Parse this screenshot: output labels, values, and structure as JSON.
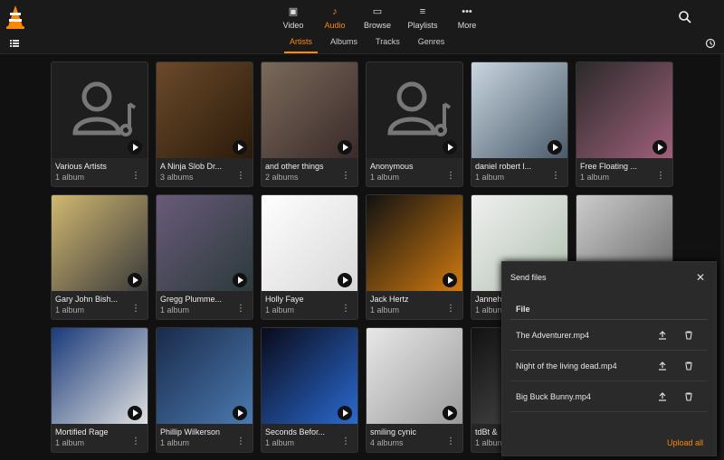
{
  "nav": [
    {
      "label": "Video",
      "icon": "film-icon"
    },
    {
      "label": "Audio",
      "icon": "music-note-icon",
      "active": true
    },
    {
      "label": "Browse",
      "icon": "folder-icon"
    },
    {
      "label": "Playlists",
      "icon": "playlist-icon"
    },
    {
      "label": "More",
      "icon": "more-dots-icon"
    }
  ],
  "tabs": [
    "Artists",
    "Albums",
    "Tracks",
    "Genres"
  ],
  "artists": [
    {
      "name": "Various Artists",
      "count": "1 album"
    },
    {
      "name": "A Ninja Slob Dr...",
      "count": "3 albums"
    },
    {
      "name": "and other things",
      "count": "2 albums"
    },
    {
      "name": "Anonymous",
      "count": "1 album"
    },
    {
      "name": "daniel robert l...",
      "count": "1 album"
    },
    {
      "name": "Free Floating ...",
      "count": "1 album"
    },
    {
      "name": "Gary John Bish...",
      "count": "1 album"
    },
    {
      "name": "Gregg Plumme...",
      "count": "1 album"
    },
    {
      "name": "Holly Faye",
      "count": "1 album"
    },
    {
      "name": "Jack Hertz",
      "count": "1 album"
    },
    {
      "name": "Janneh",
      "count": "1 album"
    },
    {
      "name": "",
      "count": ""
    },
    {
      "name": "Mortified Rage",
      "count": "1 album"
    },
    {
      "name": "Phillip Wilkerson",
      "count": "1 album"
    },
    {
      "name": "Seconds Befor...",
      "count": "1 album"
    },
    {
      "name": "smiling cynic",
      "count": "4 albums"
    },
    {
      "name": "tdBt &",
      "count": "1 album"
    }
  ],
  "modal": {
    "title": "Send files",
    "header": "File",
    "files": [
      "The Adventurer.mp4",
      "Night of the living dead.mp4",
      "Big Buck Bunny.mp4"
    ],
    "upload_all": "Upload all"
  },
  "colors": {
    "accent": "#ff8800"
  }
}
